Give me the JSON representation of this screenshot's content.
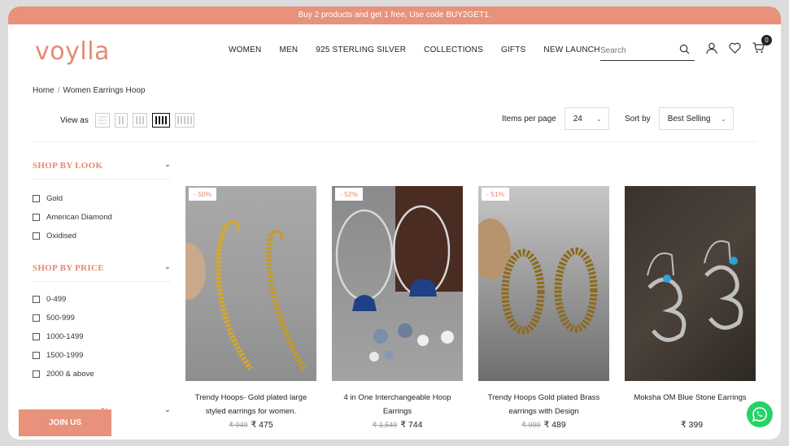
{
  "promo": {
    "text": "Buy 2 products and get 1 free, Use code BUY2GET1."
  },
  "brand": {
    "logo": "voylla",
    "accent": "#e58a73"
  },
  "nav": {
    "items": [
      "WOMEN",
      "MEN",
      "925 STERLING SILVER",
      "COLLECTIONS",
      "GIFTS",
      "NEW LAUNCHES"
    ]
  },
  "search": {
    "placeholder": "Search",
    "icon": "search-icon"
  },
  "header_icons": {
    "account": "user-icon",
    "wishlist": "heart-icon",
    "cart": "cart-icon",
    "cart_count": "0"
  },
  "breadcrumb": {
    "home": "Home",
    "separator": "/",
    "current": "Women Earrings Hoop"
  },
  "toolbar": {
    "view_as_label": "View as",
    "items_per_page_label": "Items per page",
    "items_per_page_value": "24",
    "sort_by_label": "Sort by",
    "sort_by_value": "Best Selling"
  },
  "filters": {
    "look": {
      "title": "SHOP BY LOOK",
      "options": [
        "Gold",
        "American Diamond",
        "Oxidised"
      ]
    },
    "price": {
      "title": "SHOP BY PRICE",
      "options": [
        "0-499",
        "500-999",
        "1000-1499",
        "1500-1999",
        "2000 & above"
      ]
    },
    "third": {
      "title": "N"
    }
  },
  "products": [
    {
      "discount": "- 50%",
      "title": "Trendy Hoops- Gold plated large styled earrings for women.",
      "old_price": "₹ 949",
      "price": "₹ 475"
    },
    {
      "discount": "- 52%",
      "title": "4 in One Interchangeable Hoop Earrings",
      "old_price": "₹ 1,549",
      "price": "₹ 744"
    },
    {
      "discount": "- 51%",
      "title": "Trendy Hoops Gold plated Brass earrings with Design",
      "old_price": "₹ 999",
      "price": "₹ 489"
    },
    {
      "discount": "",
      "title": "Moksha OM Blue Stone Earrings",
      "old_price": "",
      "price": "₹ 399"
    }
  ],
  "join_us": {
    "label": "JOIN US"
  },
  "whatsapp": {
    "icon": "whatsapp-icon"
  }
}
